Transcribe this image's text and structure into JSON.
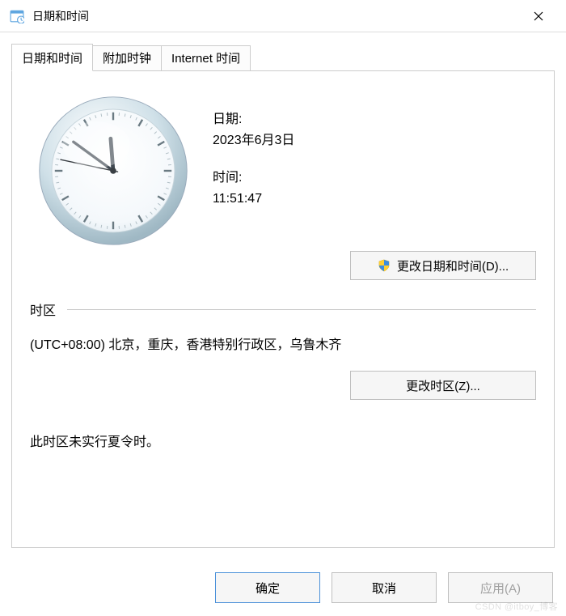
{
  "window": {
    "title": "日期和时间",
    "close_icon_name": "close-icon"
  },
  "tabs": [
    {
      "label": "日期和时间",
      "active": true
    },
    {
      "label": "附加时钟",
      "active": false
    },
    {
      "label": "Internet 时间",
      "active": false
    }
  ],
  "datetime": {
    "date_label": "日期:",
    "date_value": "2023年6月3日",
    "time_label": "时间:",
    "time_value": "11:51:47",
    "clock": {
      "hour": 11,
      "minute": 51,
      "second": 47
    },
    "change_button": "更改日期和时间(D)..."
  },
  "timezone": {
    "section_label": "时区",
    "text": "(UTC+08:00) 北京，重庆，香港特别行政区，乌鲁木齐",
    "change_button": "更改时区(Z)..."
  },
  "dst_text": "此时区未实行夏令时。",
  "footer": {
    "ok": "确定",
    "cancel": "取消",
    "apply": "应用(A)"
  },
  "watermark": "CSDN @itboy_博客",
  "colors": {
    "border": "#cccccc",
    "button_bg": "#f6f6f6",
    "primary_border": "#4a90d9"
  }
}
